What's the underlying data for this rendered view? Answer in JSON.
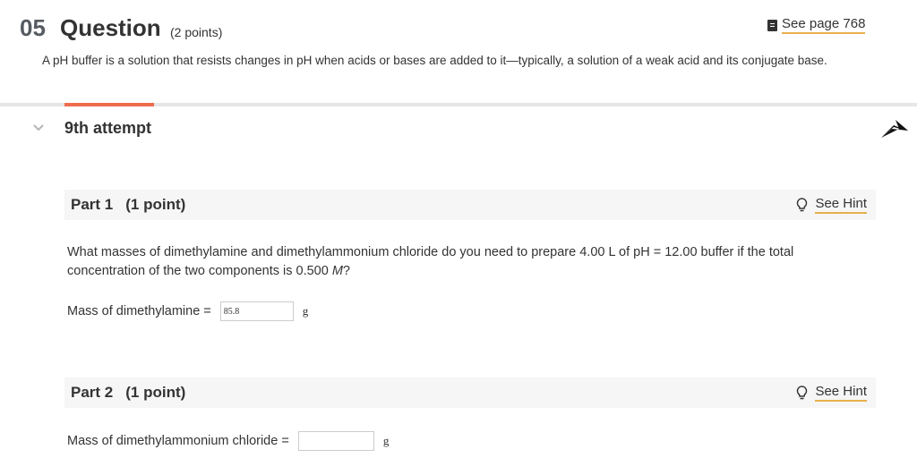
{
  "question": {
    "number": "05",
    "title": "Question",
    "points": "(2 points)",
    "see_page": "See page 768",
    "text": "A pH buffer is a solution that resists changes in pH when acids or bases are added to it—typically, a solution of a weak acid and its conjugate base."
  },
  "attempt": {
    "label": "9th attempt"
  },
  "parts": [
    {
      "title": "Part 1",
      "points": "(1 point)",
      "hint": "See Hint",
      "question": "What masses of dimethylamine and dimethylammonium chloride do you need to prepare 4.00 L of pH = 12.00 buffer if the total concentration of the two components is 0.500",
      "question_unit": "M",
      "question_end": "?",
      "answer_label": "Mass of dimethylamine =",
      "answer_value": "85.8",
      "answer_unit": "g"
    },
    {
      "title": "Part 2",
      "points": "(1 point)",
      "hint": "See Hint",
      "answer_label": "Mass of dimethylammonium chloride =",
      "answer_value": "",
      "answer_unit": "g"
    }
  ],
  "colors": {
    "accent": "#ee6b4d",
    "link_underline": "#e8b04b",
    "part_bar_bg": "#f6f6f6"
  }
}
